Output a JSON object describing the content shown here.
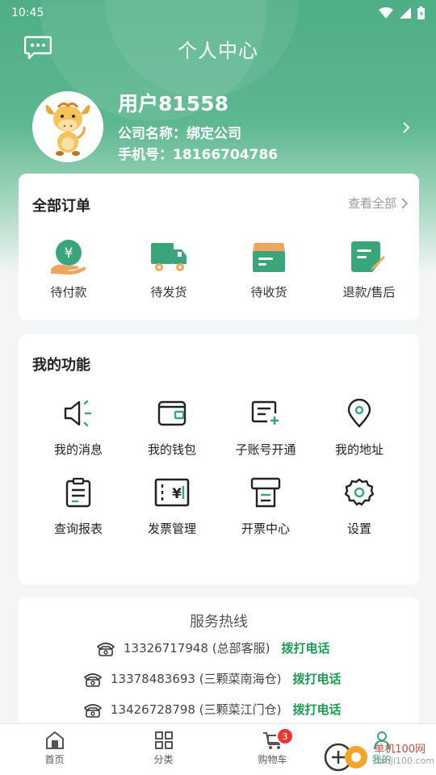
{
  "status_bar": {
    "time": "10:45"
  },
  "header": {
    "title": "个人中心"
  },
  "profile": {
    "name": "用户81558",
    "company": "公司名称：绑定公司",
    "phone": "手机号：18166704786"
  },
  "orders": {
    "title": "全部订单",
    "view_all": "查看全部",
    "items": [
      {
        "label": "待付款",
        "icon": "payment-icon"
      },
      {
        "label": "待发货",
        "icon": "truck-icon"
      },
      {
        "label": "待收货",
        "icon": "box-icon"
      },
      {
        "label": "退款/售后",
        "icon": "refund-icon"
      }
    ]
  },
  "functions": {
    "title": "我的功能",
    "items": [
      {
        "label": "我的消息",
        "icon": "speaker-icon"
      },
      {
        "label": "我的钱包",
        "icon": "wallet-icon"
      },
      {
        "label": "子账号开通",
        "icon": "add-account-icon"
      },
      {
        "label": "我的地址",
        "icon": "location-icon"
      },
      {
        "label": "查询报表",
        "icon": "clipboard-icon"
      },
      {
        "label": "发票管理",
        "icon": "invoice-icon"
      },
      {
        "label": "开票中心",
        "icon": "printer-icon"
      },
      {
        "label": "设置",
        "icon": "gear-icon"
      }
    ]
  },
  "hotline": {
    "title": "服务热线",
    "lines": [
      {
        "number": "13326717948 (总部客服)",
        "action": "拨打电话"
      },
      {
        "number": "13378483693 (三颗菜南海仓)",
        "action": "拨打电话"
      },
      {
        "number": "13426728798 (三颗菜江门仓)",
        "action": "拨打电话"
      }
    ]
  },
  "tabbar": {
    "tabs": [
      {
        "label": "首页"
      },
      {
        "label": "分类"
      },
      {
        "label": "购物车",
        "badge": "3"
      },
      {
        "label": "我的"
      }
    ]
  },
  "watermark": {
    "text": "单机100网",
    "subtext": "danji100.com"
  },
  "colors": {
    "brand": "#4fae86",
    "accent_green": "#1f9a54",
    "badge": "#e53935"
  }
}
